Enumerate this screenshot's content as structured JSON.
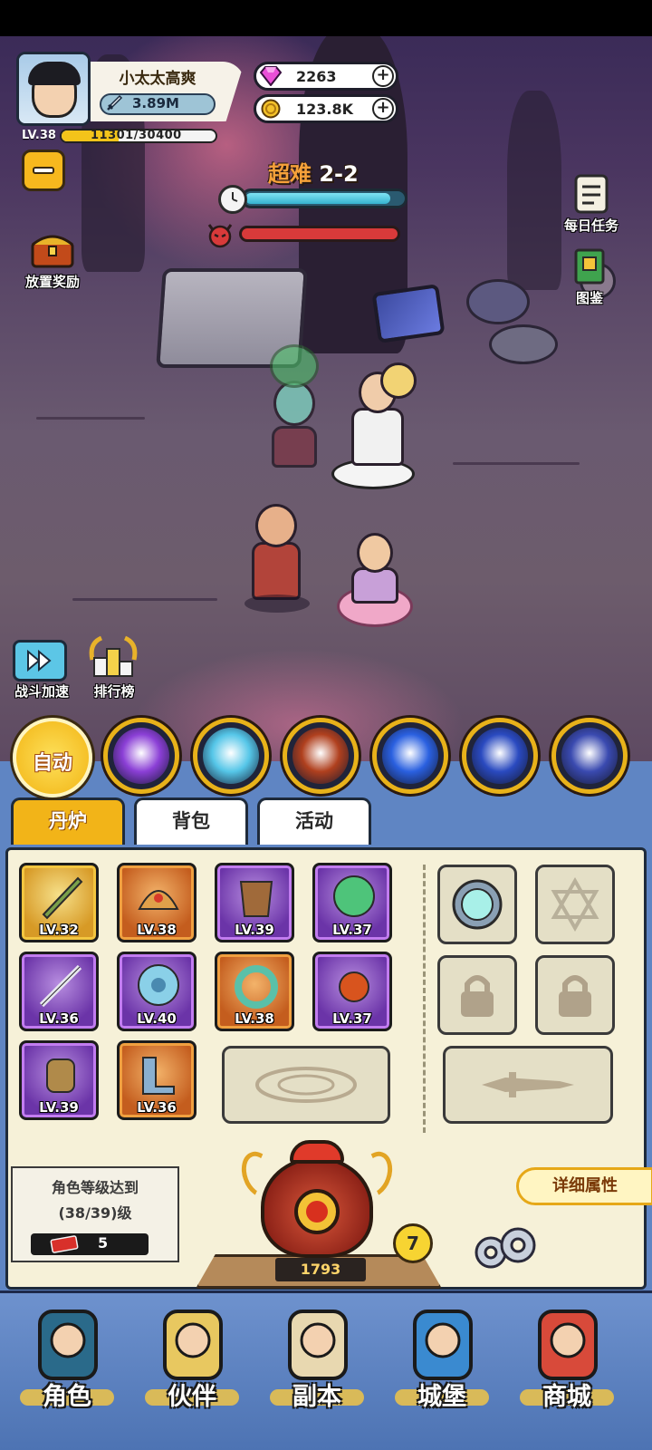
{
  "player": {
    "name": "小太太高爽",
    "power": "3.89M",
    "level_label": "LV.38",
    "exp_text": "11301/30400",
    "exp_fraction": 0.372
  },
  "currencies": {
    "gems": "2263",
    "coins": "123.8K"
  },
  "stage": {
    "difficulty": "超难",
    "number": "2-2",
    "timer_fraction": 0.92,
    "boss_hp_fraction": 1.0
  },
  "side_buttons": {
    "idle_reward": "放置奖励",
    "daily_task": "每日任务",
    "codex": "图鉴",
    "battle_speed": "战斗加速",
    "leaderboard": "排行榜"
  },
  "skills": {
    "auto_label": "自动",
    "items": [
      {
        "icon": "purple-vortex-icon",
        "color": "#8b3fd6"
      },
      {
        "icon": "white-qilin-icon",
        "color": "#55c6e8"
      },
      {
        "icon": "lion-beast-icon",
        "color": "#b0401e"
      },
      {
        "icon": "blue-comet-icon",
        "color": "#2a60e0"
      },
      {
        "icon": "water-drops-icon",
        "color": "#2a4ac0"
      },
      {
        "icon": "lightning-scroll-icon",
        "color": "#3a4ab0"
      }
    ]
  },
  "tabs": {
    "furnace": "丹炉",
    "backpack": "背包",
    "activity": "活动"
  },
  "equipment": [
    {
      "level": "LV.32",
      "rarity": "gold",
      "icon": "jade-sword-icon"
    },
    {
      "level": "LV.38",
      "rarity": "orange",
      "icon": "crown-helmet-icon"
    },
    {
      "level": "LV.39",
      "rarity": "purple",
      "icon": "armor-icon"
    },
    {
      "level": "LV.37",
      "rarity": "purple",
      "icon": "dragon-orb-icon"
    },
    {
      "level": "LV.36",
      "rarity": "purple",
      "icon": "spear-icon"
    },
    {
      "level": "LV.40",
      "rarity": "purple",
      "icon": "jade-disc-icon"
    },
    {
      "level": "LV.38",
      "rarity": "orange",
      "icon": "jade-ring-icon"
    },
    {
      "level": "LV.37",
      "rarity": "purple",
      "icon": "fire-pearl-icon"
    },
    {
      "level": "LV.39",
      "rarity": "purple",
      "icon": "bracer-icon"
    },
    {
      "level": "LV.36",
      "rarity": "orange",
      "icon": "boots-icon"
    }
  ],
  "requirement": {
    "line1": "角色等级达到",
    "line2": "(38/39)级",
    "ticket_count": "5"
  },
  "furnace": {
    "count": "1793",
    "level": "7"
  },
  "detail_button": "详细属性",
  "nav": [
    {
      "label": "角色",
      "icon": "character-icon"
    },
    {
      "label": "伙伴",
      "icon": "partner-icon"
    },
    {
      "label": "副本",
      "icon": "dungeon-scroll-icon"
    },
    {
      "label": "城堡",
      "icon": "castle-icon"
    },
    {
      "label": "商城",
      "icon": "shop-icon"
    }
  ]
}
